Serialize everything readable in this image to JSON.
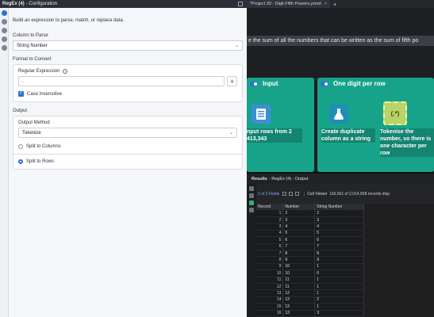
{
  "config": {
    "title_bold": "RegEx (4)",
    "title_rest": "- Configuration",
    "description": "Build an expression to parse, match, or replace data.",
    "column_label": "Column to Parse",
    "column_value": "String Number",
    "format_label": "Format to Convert",
    "regex_label": "Regular Expression",
    "regex_value": ".",
    "case_label": "Case Insensitive",
    "output_label": "Output",
    "method_label": "Output Method",
    "method_value": "Tokenize",
    "split_columns": "Split to Columns",
    "split_rows": "Split to Rows"
  },
  "tabs": [
    {
      "label": "*Project 30 - Digit Fifth Powers.yxmd",
      "close": "×"
    }
  ],
  "tab_plus": "+",
  "canvas": {
    "comment": "e the sum of all the numbers that can be written as the sum of fifth po",
    "container_input": "Input",
    "container_digit": "One digit per row",
    "tool_input_label": "nput rows from 2 413,343",
    "tool_dup_label": "Create duplicate column as a string",
    "tool_regex_label": "Tokenise the number, so there is one character per row",
    "regex_tool_glyph": "(.*)"
  },
  "results": {
    "title_bold": "Results",
    "title_rest": "- RegEx (4) - Output",
    "fields_chip": "2 of 2 Fields",
    "viewer": "Cell Viewer",
    "records_info": "116,561 of 2,014,658 records disp",
    "columns": [
      "Record",
      "Number",
      "String Number"
    ],
    "rows": [
      [
        "1",
        "2",
        "2"
      ],
      [
        "2",
        "3",
        "3"
      ],
      [
        "3",
        "4",
        "4"
      ],
      [
        "4",
        "5",
        "5"
      ],
      [
        "5",
        "6",
        "6"
      ],
      [
        "6",
        "7",
        "7"
      ],
      [
        "7",
        "8",
        "8"
      ],
      [
        "8",
        "9",
        "9"
      ],
      [
        "9",
        "10",
        "1"
      ],
      [
        "10",
        "10",
        "0"
      ],
      [
        "11",
        "11",
        "1"
      ],
      [
        "12",
        "11",
        "1"
      ],
      [
        "13",
        "12",
        "1"
      ],
      [
        "14",
        "12",
        "2"
      ],
      [
        "15",
        "13",
        "1"
      ],
      [
        "16",
        "13",
        "3"
      ]
    ]
  },
  "colors": {
    "accent": "#2f6fd6",
    "container": "#17a38a",
    "input_tool": "#3a8fd6",
    "prep_tool": "#1f8fb3",
    "parse_tool": "#b9d36b"
  }
}
